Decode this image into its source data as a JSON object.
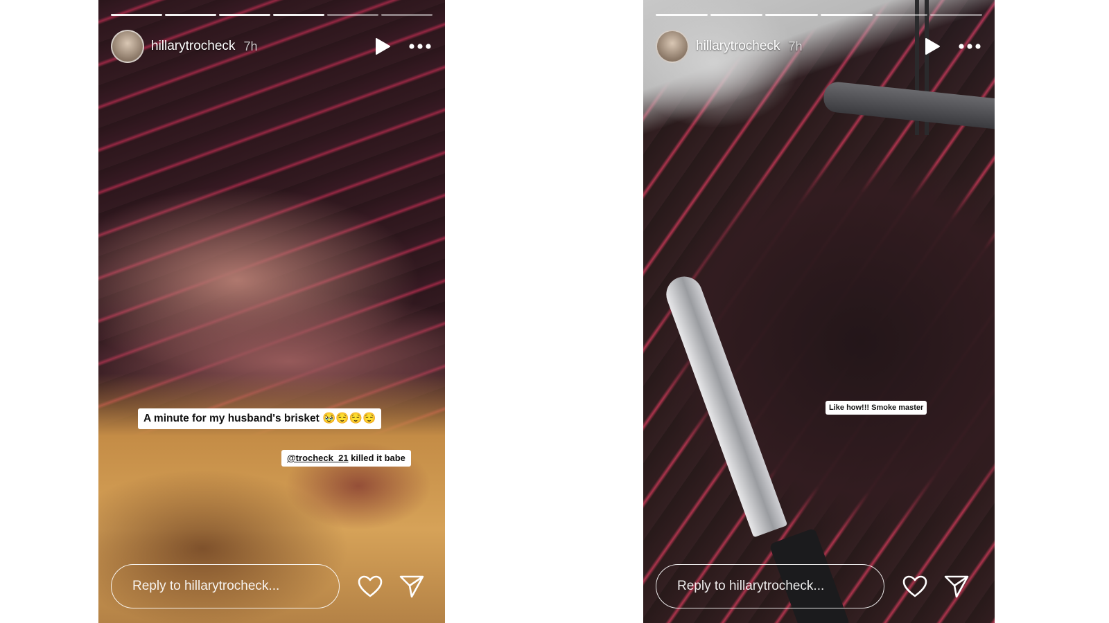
{
  "stories": [
    {
      "username": "hillarytrocheck",
      "time": "7h",
      "progress_segments": 6,
      "active_segments": 4,
      "reply_placeholder": "Reply to hillarytrocheck...",
      "caption_main": "A minute for my husband's brisket 🥹😌😌😌",
      "mention": "@trocheck_21",
      "mention_suffix": " killed it babe"
    },
    {
      "username": "hillarytrocheck",
      "time": "7h",
      "progress_segments": 6,
      "active_segments": 4,
      "reply_placeholder": "Reply to hillarytrocheck...",
      "caption": "Like how!!! Smoke master"
    }
  ],
  "icons": {
    "play": "play-icon",
    "more": "more-icon",
    "heart": "heart-icon",
    "send": "send-icon"
  }
}
